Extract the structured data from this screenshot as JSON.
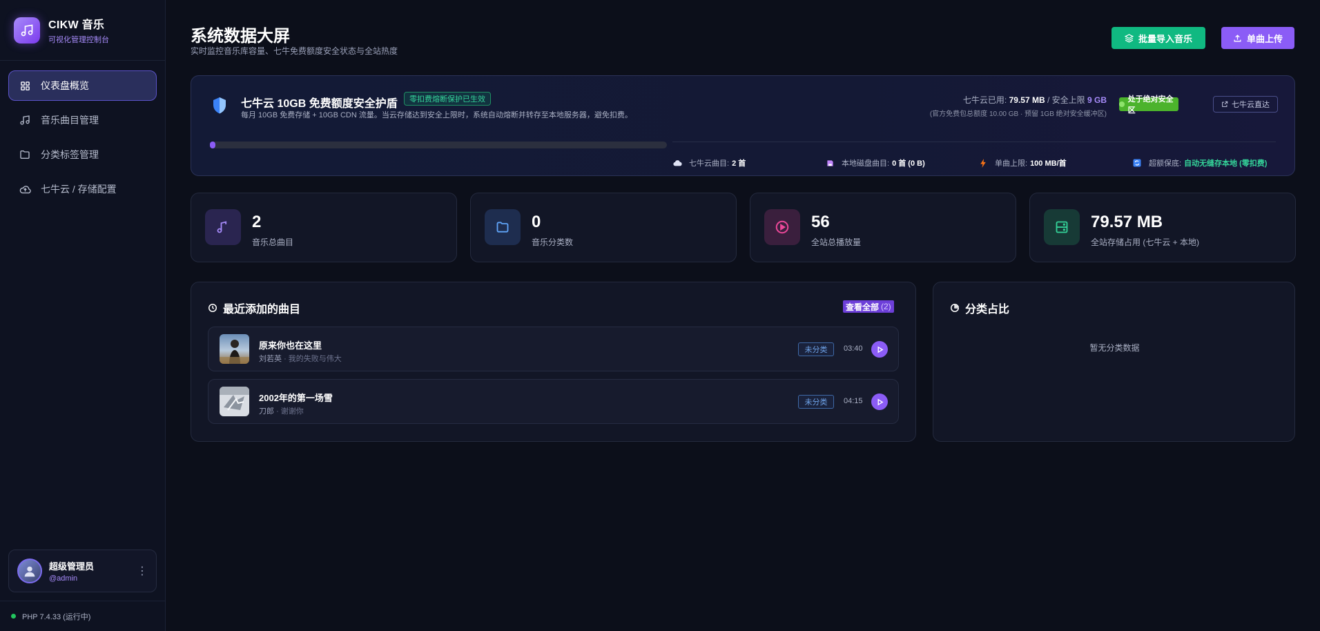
{
  "brand": {
    "title": "CIKW 音乐",
    "subtitle": "可视化管理控制台"
  },
  "sidebar": {
    "items": [
      {
        "label": "仪表盘概览",
        "icon": "grid-icon",
        "active": true
      },
      {
        "label": "音乐曲目管理",
        "icon": "music-note-icon",
        "active": false
      },
      {
        "label": "分类标签管理",
        "icon": "folder-icon",
        "active": false
      },
      {
        "label": "七牛云 / 存储配置",
        "icon": "cloud-upload-icon",
        "active": false
      }
    ]
  },
  "user": {
    "name": "超级管理员",
    "handle": "@admin"
  },
  "status": {
    "php": "PHP 7.4.33 (运行中)"
  },
  "header": {
    "title": "系统数据大屏",
    "subtitle": "实时监控音乐库容量、七牛免费额度安全状态与全站热度",
    "batch_import": "批量导入音乐",
    "single_upload": "单曲上传"
  },
  "shield": {
    "title": "七牛云 10GB 免费额度安全护盾",
    "badge": "零扣费熔断保护已生效",
    "description": "每月 10GB 免费存储 + 10GB CDN 流量。当云存储达到安全上限时，系统自动熔断并转存至本地服务器，避免扣费。",
    "used_label": "七牛云已用:",
    "used_value": "79.57 MB",
    "limit_label": "/ 安全上限",
    "limit_value": "9 GB",
    "note": "(官方免费包总额度 10.00 GB · 预留 1GB 绝对安全缓冲区)",
    "safe_badge": "处于绝对安全区",
    "direct_link": "七牛云直达",
    "progress": 0.0086,
    "stats": {
      "cloud_label": "七牛云曲目:",
      "cloud_value": "2 首",
      "local_label": "本地磁盘曲目:",
      "local_value": "0 首 (0 B)",
      "limit_label": "单曲上限:",
      "limit_value": "100 MB/首",
      "fallback_label": "超额保底:",
      "fallback_value": "自动无缝存本地 (零扣费)"
    }
  },
  "kpis": [
    {
      "value": "2",
      "label": "音乐总曲目",
      "icon": "music-note-icon",
      "color": "#a78bfa"
    },
    {
      "value": "0",
      "label": "音乐分类数",
      "icon": "folder-icon",
      "color": "#60a5fa"
    },
    {
      "value": "56",
      "label": "全站总播放量",
      "icon": "play-circle-icon",
      "color": "#ec4899"
    },
    {
      "value": "79.57 MB",
      "label": "全站存储占用 (七牛云 + 本地)",
      "icon": "server-icon",
      "color": "#34d399"
    }
  ],
  "recent": {
    "title": "最近添加的曲目",
    "view_all": "查看全部",
    "view_all_count": "(2)",
    "tracks": [
      {
        "title": "原来你也在这里",
        "artist": "刘若英",
        "album": "· 我的失败与伟大",
        "tag": "未分类",
        "duration": "03:40"
      },
      {
        "title": "2002年的第一场雪",
        "artist": "刀郎",
        "album": "· 谢谢你",
        "tag": "未分类",
        "duration": "04:15"
      }
    ]
  },
  "category": {
    "title": "分类占比",
    "empty": "暂无分类数据"
  },
  "colors": {
    "accent": "#8b5cf6",
    "success": "#10b981",
    "background": "#0c0f1a"
  }
}
